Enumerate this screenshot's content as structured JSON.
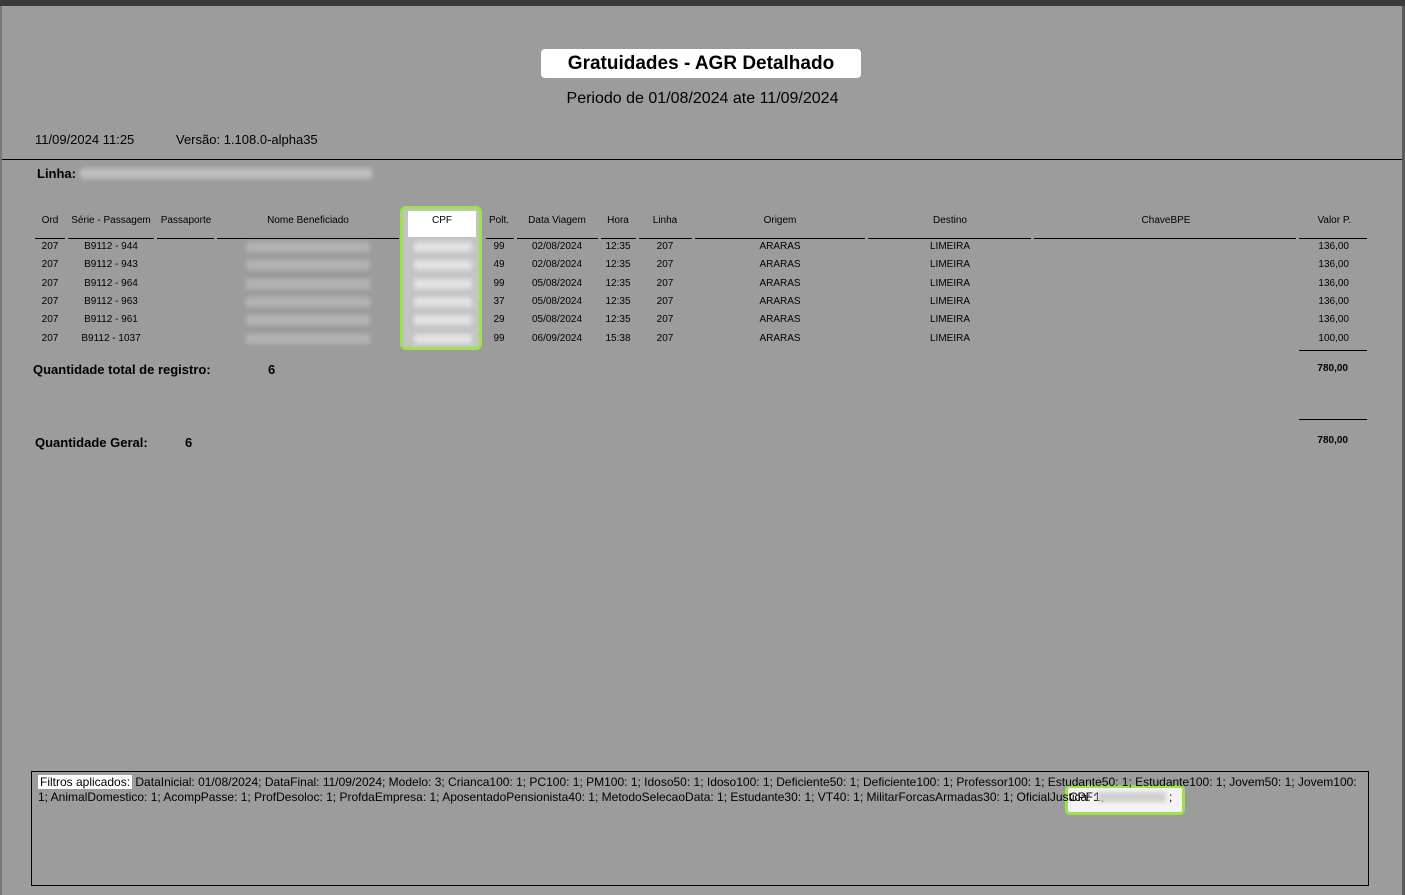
{
  "report": {
    "title": "Gratuidades - AGR Detalhado",
    "period": "Periodo de 01/08/2024 ate 11/09/2024",
    "timestamp": "11/09/2024 11:25",
    "version": "Versão: 1.108.0-alpha35",
    "linha_label": "Linha:"
  },
  "table": {
    "headers": {
      "ord": "Ord",
      "serie": "Série - Passagem",
      "passaporte": "Passaporte",
      "nome": "Nome Beneficiado",
      "cpf": "CPF",
      "polt": "Polt.",
      "data": "Data Viagem",
      "hora": "Hora",
      "linha": "Linha",
      "origem": "Origem",
      "destino": "Destino",
      "chave": "ChaveBPE",
      "valor": "Valor P."
    },
    "rows": [
      {
        "ord": "207",
        "serie": "B9112 - 944",
        "polt": "99",
        "data": "02/08/2024",
        "hora": "12:35",
        "linha": "207",
        "origem": "ARARAS",
        "destino": "LIMEIRA",
        "valor": "136,00"
      },
      {
        "ord": "207",
        "serie": "B9112 - 943",
        "polt": "49",
        "data": "02/08/2024",
        "hora": "12:35",
        "linha": "207",
        "origem": "ARARAS",
        "destino": "LIMEIRA",
        "valor": "136,00"
      },
      {
        "ord": "207",
        "serie": "B9112 - 964",
        "polt": "99",
        "data": "05/08/2024",
        "hora": "12:35",
        "linha": "207",
        "origem": "ARARAS",
        "destino": "LIMEIRA",
        "valor": "136,00"
      },
      {
        "ord": "207",
        "serie": "B9112 - 963",
        "polt": "37",
        "data": "05/08/2024",
        "hora": "12:35",
        "linha": "207",
        "origem": "ARARAS",
        "destino": "LIMEIRA",
        "valor": "136,00"
      },
      {
        "ord": "207",
        "serie": "B9112 - 961",
        "polt": "29",
        "data": "05/08/2024",
        "hora": "12:35",
        "linha": "207",
        "origem": "ARARAS",
        "destino": "LIMEIRA",
        "valor": "136,00"
      },
      {
        "ord": "207",
        "serie": "B9112 - 1037",
        "polt": "99",
        "data": "06/09/2024",
        "hora": "15:38",
        "linha": "207",
        "origem": "ARARAS",
        "destino": "LIMEIRA",
        "valor": "100,00"
      }
    ]
  },
  "totals": {
    "registro_label": "Quantidade total de registro:",
    "registro_count": "6",
    "registro_sum": "780,00",
    "geral_label": "Quantidade Geral:",
    "geral_count": "6",
    "geral_sum": "780,00"
  },
  "filters": {
    "label": "Filtros aplicados:",
    "text": "DataInicial: 01/08/2024; DataFinal: 11/09/2024; Modelo: 3; Crianca100: 1; PC100: 1; PM100: 1; Idoso50: 1; Idoso100: 1; Deficiente50: 1; Deficiente100: 1; Professor100: 1; Estudante50: 1; Estudante100: 1; Jovem50: 1; Jovem100: 1; AnimalDomestico: 1; AcompPasse: 1; ProfDesoloc: 1; ProfdaEmpresa: 1; AposentadoPensionista40: 1; MetodoSelecaoData: 1; Estudante30: 1; VT40: 1; MilitarForcasArmadas30: 1; OficialJustica: 1;",
    "cpf_label": "CPF:",
    "cpf_semicolon": ";"
  },
  "colors": {
    "page_bg": "#9c9c9c",
    "highlight": "#9ee04e"
  }
}
